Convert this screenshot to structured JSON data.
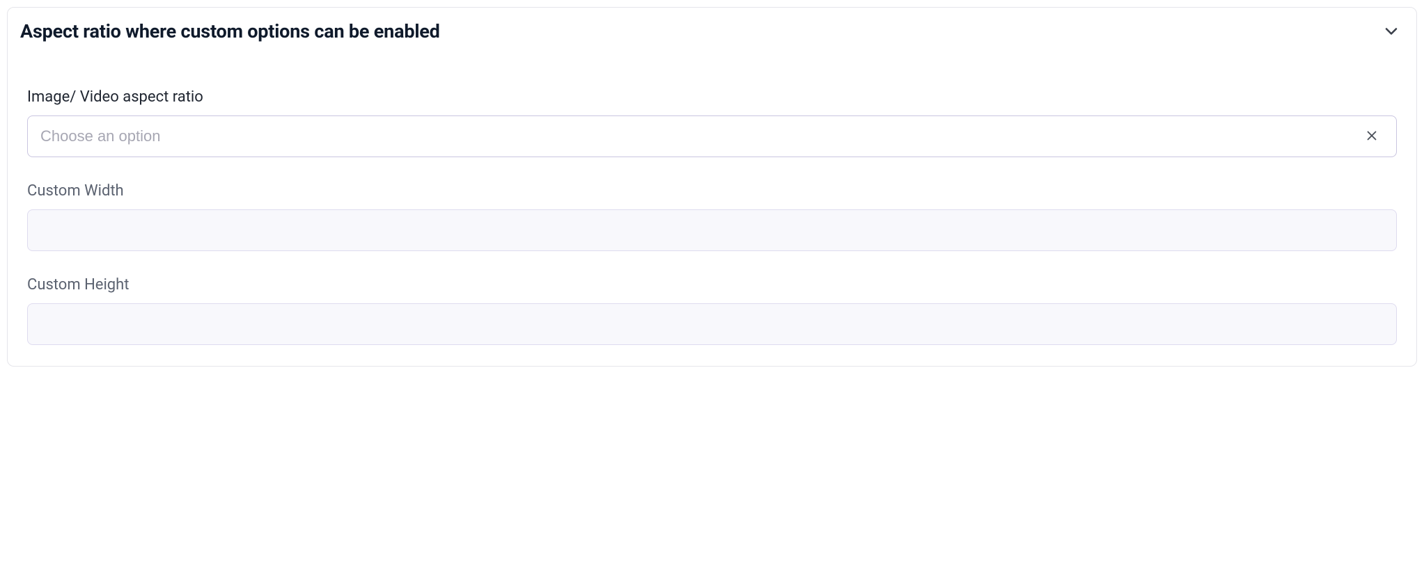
{
  "panel": {
    "title": "Aspect ratio where custom options can be enabled"
  },
  "fields": {
    "aspect_ratio": {
      "label": "Image/ Video aspect ratio",
      "placeholder": "Choose an option",
      "value": ""
    },
    "custom_width": {
      "label": "Custom Width",
      "value": ""
    },
    "custom_height": {
      "label": "Custom Height",
      "value": ""
    }
  }
}
